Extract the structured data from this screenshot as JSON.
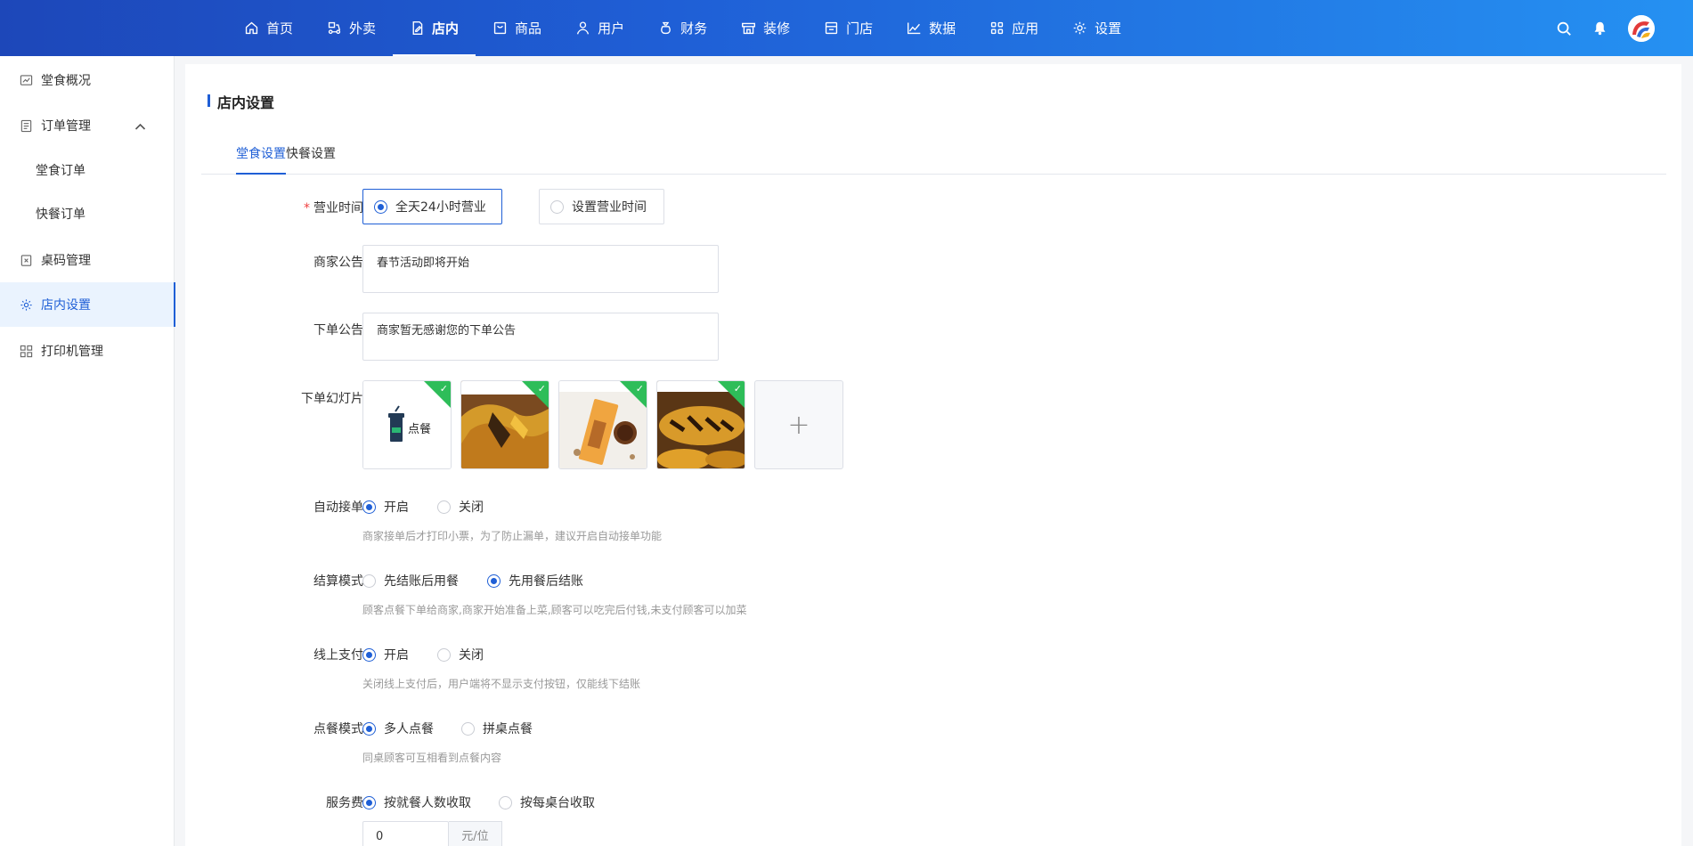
{
  "topnav": {
    "items": [
      {
        "label": "首页",
        "icon": "home-icon"
      },
      {
        "label": "外卖",
        "icon": "scooter-icon"
      },
      {
        "label": "店内",
        "icon": "store-edit-icon"
      },
      {
        "label": "商品",
        "icon": "goods-icon"
      },
      {
        "label": "用户",
        "icon": "user-icon"
      },
      {
        "label": "财务",
        "icon": "money-bag-icon"
      },
      {
        "label": "装修",
        "icon": "shopfront-icon"
      },
      {
        "label": "门店",
        "icon": "store-icon"
      },
      {
        "label": "数据",
        "icon": "line-chart-icon"
      },
      {
        "label": "应用",
        "icon": "apps-grid-icon"
      },
      {
        "label": "设置",
        "icon": "gear-icon"
      }
    ],
    "active": "店内"
  },
  "sidebar": {
    "items": [
      {
        "label": "堂食概况",
        "icon": "dashboard-icon"
      },
      {
        "label": "订单管理",
        "icon": "document-icon"
      },
      {
        "label": "堂食订单"
      },
      {
        "label": "快餐订单"
      },
      {
        "label": "桌码管理",
        "icon": "table-code-icon"
      },
      {
        "label": "店内设置",
        "icon": "gear-icon"
      },
      {
        "label": "打印机管理",
        "icon": "printer-grid-icon"
      }
    ],
    "active": "店内设置"
  },
  "page": {
    "title": "店内设置",
    "tabs": [
      "堂食设置",
      "快餐设置"
    ],
    "active_tab": "堂食设置"
  },
  "form": {
    "business_hours": {
      "required_mark": "*",
      "label": "营业时间",
      "options": [
        "全天24小时营业",
        "设置营业时间"
      ],
      "selected": "全天24小时营业"
    },
    "merchant_notice": {
      "label": "商家公告",
      "value": "春节活动即将开始"
    },
    "order_notice": {
      "label": "下单公告",
      "value": "商家暂无感谢您的下单公告"
    },
    "slides": {
      "label": "下单幻灯片",
      "images": [
        {
          "name": "diancan-logo-slide",
          "caption": "点餐",
          "checked": true
        },
        {
          "name": "bread-slide-1",
          "checked": true
        },
        {
          "name": "bread-drink-slide",
          "checked": true
        },
        {
          "name": "bread-slide-2",
          "checked": true
        }
      ],
      "add_symbol": "+",
      "check_symbol": "✓"
    },
    "auto_accept": {
      "label": "自动接单",
      "options": [
        "开启",
        "关闭"
      ],
      "selected": "开启",
      "hint": "商家接单后才打印小票，为了防止漏单，建议开启自动接单功能"
    },
    "settlement": {
      "label": "结算模式",
      "options": [
        "先结账后用餐",
        "先用餐后结账"
      ],
      "selected": "先用餐后结账",
      "hint": "顾客点餐下单给商家,商家开始准备上菜,顾客可以吃完后付钱,未支付顾客可以加菜"
    },
    "online_pay": {
      "label": "线上支付",
      "options": [
        "开启",
        "关闭"
      ],
      "selected": "开启",
      "hint": "关闭线上支付后，用户端将不显示支付按钮，仅能线下结账"
    },
    "order_mode": {
      "label": "点餐模式",
      "options": [
        "多人点餐",
        "拼桌点餐"
      ],
      "selected": "多人点餐",
      "hint": "同桌顾客可互相看到点餐内容"
    },
    "service_fee": {
      "label": "服务费",
      "options": [
        "按就餐人数收取",
        "按每桌台收取"
      ],
      "selected": "按就餐人数收取",
      "value": "0",
      "unit": "元/位"
    }
  },
  "colors": {
    "primary": "#1f5fd6",
    "nav_gradient_start": "#1d47b9",
    "nav_gradient_end": "#2591f2",
    "check_green": "#2ebd59",
    "required": "#f04040"
  }
}
